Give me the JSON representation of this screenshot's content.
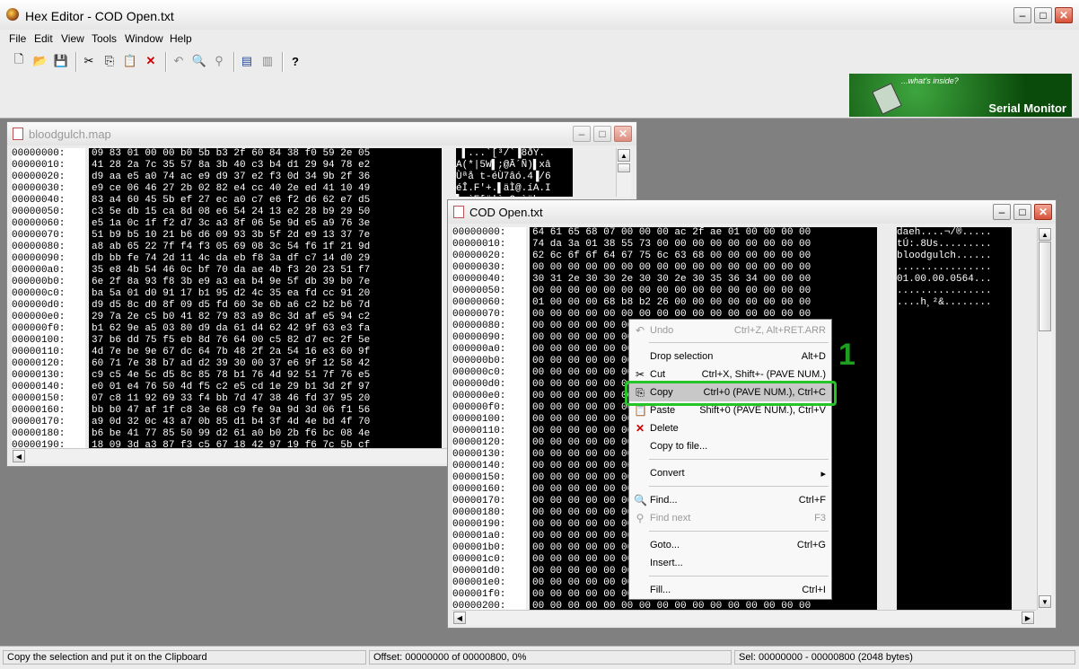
{
  "window": {
    "title": "Hex Editor - COD Open.txt"
  },
  "menu": [
    "File",
    "Edit",
    "View",
    "Tools",
    "Window",
    "Help"
  ],
  "toolbar": {
    "icons": [
      "new-file-icon",
      "open-folder-icon",
      "save-icon",
      "cut-icon",
      "copy-icon",
      "paste-icon",
      "delete-icon",
      "undo-icon",
      "find-icon",
      "find-next-icon",
      "goto-icon",
      "insert-icon",
      "help-icon"
    ],
    "glyphs": [
      "🗋",
      "📂",
      "💾",
      "✂",
      "⎘",
      "📋",
      "✕",
      "↶",
      "🔍",
      "⚲",
      "▤",
      "▥",
      "?"
    ]
  },
  "banner": {
    "tagline": "...what's inside?",
    "title": "Serial Monitor"
  },
  "windows": {
    "bloodgulch": {
      "title": "bloodgulch.map",
      "addresses": [
        "00000000:",
        "00000010:",
        "00000020:",
        "00000030:",
        "00000040:",
        "00000050:",
        "00000060:",
        "00000070:",
        "00000080:",
        "00000090:",
        "000000a0:",
        "000000b0:",
        "000000c0:",
        "000000d0:",
        "000000e0:",
        "000000f0:",
        "00000100:",
        "00000110:",
        "00000120:",
        "00000130:",
        "00000140:",
        "00000150:",
        "00000160:",
        "00000170:",
        "00000180:",
        "00000190:"
      ],
      "hex": [
        "09 83 01 00 00 b0 5b b3 2f 60 84 38 f0 59 2e 05",
        "41 28 2a 7c 35 57 8a 3b 40 c3 b4 d1 29 94 78 e2",
        "d9 aa e5 a0 74 ac e9 d9 37 e2 f3 0d 34 9b 2f 36",
        "e9 ce 06 46 27 2b 02 82 e4 cc 40 2e ed 41 10 49",
        "83 a4 60 45 5b ef 27 ec a0 c7 e6 f2 d6 62 e7 d5",
        "c3 5e db 15 ca 8d 08 e6 54 24 13 e2 28 b9 29 50",
        "e5 1a 0c 1f f2 d7 3c a3 8f 06 5e 9d e5 a9 76 3e",
        "51 b9 b5 10 21 b6 d6 09 93 3b 5f 2d e9 13 37 7e",
        "a8 ab 65 22 7f f4 f3 05 69 08 3c 54 f6 1f 21 9d",
        "db bb fe 74 2d 11 4c da eb f8 3a df c7 14 d0 29",
        "35 e8 4b 54 46 0c bf 70 da ae 4b f3 20 23 51 f7",
        "6e 2f 8a 93 f8 3b e9 a3 ea b4 9e 5f db 39 b0 7e",
        "ba 5a 01 d0 91 17 b1 95 d2 4c 35 ea fd cc 91 20",
        "d9 d5 8c d0 8f 09 d5 fd 60 3e 6b a6 c2 b2 b6 7d",
        "29 7a 2e c5 b0 41 82 79 83 a9 8c 3d af e5 94 c2",
        "b1 62 9e a5 03 80 d9 da 61 d4 62 42 9f 63 e3 fa",
        "37 b6 dd 75 f5 eb 8d 76 64 00 c5 82 d7 ec 2f 5e",
        "4d 7e be 9e 67 dc 64 7b 48 2f 2a 54 16 e3 60 9f",
        "60 71 7e 38 b7 ad d2 39 30 00 37 e6 9f 12 58 42",
        "c9 c5 4e 5c d5 8c 85 78 b1 76 4d 92 51 7f 76 e5",
        "e0 01 e4 76 50 4d f5 c2 e5 cd 1e 29 b1 3d 2f 97",
        "07 c8 11 92 69 33 f4 bb 7d 47 38 46 fd 37 95 20",
        "bb b0 47 af 1f c8 3e 68 c9 fe 9a 9d 3d 06 f1 56",
        "a9 0d 32 0c 43 a7 0b 85 d1 b4 3f 4d 4e bd 4f 70",
        "b6 be 41 77 85 50 99 d2 61 a0 b0 2b f6 bc 08 4e",
        "18 09 3d a3 87 f3 c5 67 18 42 97 19 f6 7c 5b cf"
      ],
      "ascii": [
        " ▌...`[³/`▐8ðY.",
        "A(*|5W▌;@Ã´Ñ)▌xâ",
        "Ùªå t-éÙ7âó.4▐/6",
        "éÎ.F'+.▌äÌ@.íA.I",
        "▌¤`E[ï'ì Çæòöbç"
      ]
    },
    "cod": {
      "title": "COD Open.txt",
      "addresses": [
        "00000000:",
        "00000010:",
        "00000020:",
        "00000030:",
        "00000040:",
        "00000050:",
        "00000060:",
        "00000070:",
        "00000080:",
        "00000090:",
        "000000a0:",
        "000000b0:",
        "000000c0:",
        "000000d0:",
        "000000e0:",
        "000000f0:",
        "00000100:",
        "00000110:",
        "00000120:",
        "00000130:",
        "00000140:",
        "00000150:",
        "00000160:",
        "00000170:",
        "00000180:",
        "00000190:",
        "000001a0:",
        "000001b0:",
        "000001c0:",
        "000001d0:",
        "000001e0:",
        "000001f0:",
        "00000200:"
      ],
      "hex_top": [
        "64 61 65 68 07 00 00 00 ac 2f ae 01 00 00 00 00",
        "74 da 3a 01 38 55 73 00 00 00 00 00 00 00 00 00",
        "62 6c 6f 6f 64 67 75 6c 63 68 00 00 00 00 00 00",
        "00 00 00 00 00 00 00 00 00 00 00 00 00 00 00 00",
        "30 31 2e 30 30 2e 30 30 2e 30 35 36 34 00 00 00",
        "00 00 00 00 00 00 00 00 00 00 00 00 00 00 00 00",
        "01 00 00 00 68 b8 b2 26 00 00 00 00 00 00 00 00",
        "00 00 00 00 00 00 00 00 00 00 00 00 00 00 00 00"
      ],
      "hex_fill": "00 00 00 00 00 00 00 00 00 00 00 00 00 00 00 00",
      "hex_left_fill": "00 00 00 00 0",
      "ascii": [
        "daeh....¬/®.....",
        "tÚ:.8Us.........",
        "bloodgulch......",
        "................",
        "01.00.00.0564...",
        "................",
        "....h¸²&........"
      ]
    }
  },
  "context_menu": {
    "items": [
      {
        "label": "Undo",
        "accel": "Ctrl+Z, Alt+RET.ARR",
        "disabled": true,
        "icon": "undo-icon",
        "glyph": "↶"
      },
      {
        "label": "Drop selection",
        "accel": "Alt+D",
        "disabled": false,
        "icon": "",
        "glyph": ""
      },
      {
        "label": "Cut",
        "accel": "Ctrl+X, Shift+- (PAVE NUM.)",
        "disabled": false,
        "icon": "cut-icon",
        "glyph": "✂"
      },
      {
        "label": "Copy",
        "accel": "Ctrl+0 (PAVE NUM.), Ctrl+C",
        "disabled": false,
        "icon": "copy-icon",
        "glyph": "⎘"
      },
      {
        "label": "Paste",
        "accel": "Shift+0 (PAVE NUM.), Ctrl+V",
        "disabled": false,
        "icon": "paste-icon",
        "glyph": "📋"
      },
      {
        "label": "Delete",
        "accel": "",
        "disabled": false,
        "icon": "delete-icon",
        "glyph": "✕"
      },
      {
        "label": "Copy to file...",
        "accel": "",
        "disabled": false,
        "icon": "",
        "glyph": ""
      },
      {
        "label": "Convert",
        "accel": "▸",
        "disabled": false,
        "icon": "",
        "glyph": ""
      },
      {
        "label": "Find...",
        "accel": "Ctrl+F",
        "disabled": false,
        "icon": "find-icon",
        "glyph": "🔍"
      },
      {
        "label": "Find next",
        "accel": "F3",
        "disabled": true,
        "icon": "find-next-icon",
        "glyph": "⚲"
      },
      {
        "label": "Goto...",
        "accel": "Ctrl+G",
        "disabled": false,
        "icon": "",
        "glyph": ""
      },
      {
        "label": "Insert...",
        "accel": "",
        "disabled": false,
        "icon": "",
        "glyph": ""
      },
      {
        "label": "Fill...",
        "accel": "Ctrl+I",
        "disabled": false,
        "icon": "",
        "glyph": ""
      }
    ],
    "highlighted": "Copy"
  },
  "annotation": {
    "step": "1",
    "color": "#26c426"
  },
  "statusbar": {
    "hint": "Copy the selection and put it on the Clipboard",
    "offset": "Offset: 00000000 of 00000800, 0%",
    "selection": "Sel: 00000000 - 00000800 (2048 bytes)"
  }
}
